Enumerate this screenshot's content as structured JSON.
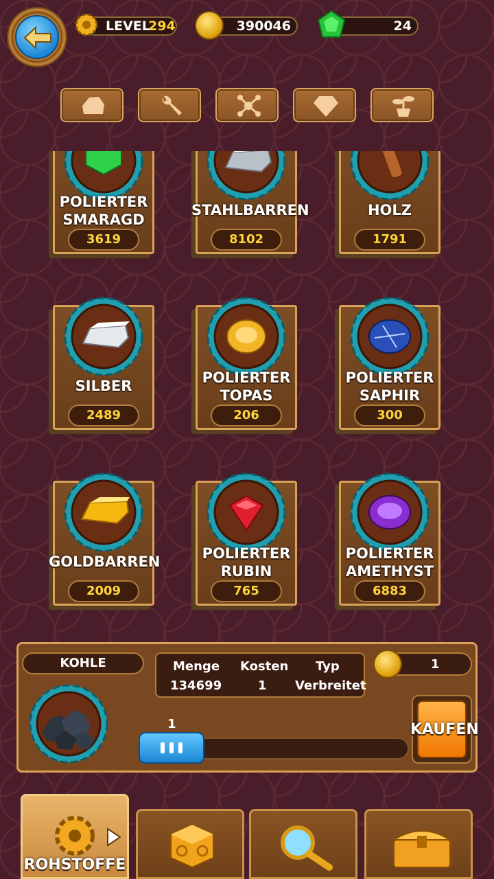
{
  "header": {
    "level_label": "LEVEL",
    "level_value": "294",
    "coins": "390046",
    "gems": "24"
  },
  "category_tabs": [
    {
      "icon": "rock-icon"
    },
    {
      "icon": "wrench-icon"
    },
    {
      "icon": "molecule-icon"
    },
    {
      "icon": "diamond-icon"
    },
    {
      "icon": "plant-icon"
    }
  ],
  "items": [
    {
      "name": "POLIERTER SMARAGD",
      "line1": "POLIERTER",
      "line2": "SMARAGD",
      "qty": "3619",
      "icon": "emerald-icon",
      "color": "#2ed14a"
    },
    {
      "name": "STAHLBARREN",
      "line1": "STAHLBARREN",
      "line2": "",
      "qty": "8102",
      "icon": "steel-bar-icon",
      "color": "#b9c0c8"
    },
    {
      "name": "HOLZ",
      "line1": "HOLZ",
      "line2": "",
      "qty": "1791",
      "icon": "wood-icon",
      "color": "#b5642c"
    },
    {
      "name": "SILBER",
      "line1": "SILBER",
      "line2": "",
      "qty": "2489",
      "icon": "silver-bar-icon",
      "color": "#e6e9ec"
    },
    {
      "name": "POLIERTER TOPAS",
      "line1": "POLIERTER",
      "line2": "TOPAS",
      "qty": "206",
      "icon": "topaz-icon",
      "color": "#f2b526"
    },
    {
      "name": "POLIERTER SAPHIR",
      "line1": "POLIERTER",
      "line2": "SAPHIR",
      "qty": "300",
      "icon": "sapphire-icon",
      "color": "#2a4fb8"
    },
    {
      "name": "GOLDBARREN",
      "line1": "GOLDBARREN",
      "line2": "",
      "qty": "2009",
      "icon": "gold-bar-icon",
      "color": "#f5b80f"
    },
    {
      "name": "POLIERTER RUBIN",
      "line1": "POLIERTER",
      "line2": "RUBIN",
      "qty": "765",
      "icon": "ruby-icon",
      "color": "#e0202c"
    },
    {
      "name": "POLIERTER AMETHYST",
      "line1": "POLIERTER",
      "line2": "AMETHYST",
      "qty": "6883",
      "icon": "amethyst-icon",
      "color": "#8a2ed0"
    }
  ],
  "detail": {
    "selected_name": "KOHLE",
    "headers": {
      "menge": "Menge",
      "kosten": "Kosten",
      "typ": "Typ"
    },
    "values": {
      "menge": "134699",
      "kosten": "1",
      "typ": "Verbreitet"
    },
    "price": "1",
    "slider_value": "1",
    "buy_label": "KAUFEN"
  },
  "bottom_nav": [
    {
      "label": "ROHSTOFFE",
      "icon": "gear-icon",
      "active": true
    },
    {
      "label": "",
      "icon": "dice-icon"
    },
    {
      "label": "",
      "icon": "magnifier-icon"
    },
    {
      "label": "",
      "icon": "chest-icon"
    }
  ],
  "colors": {
    "accent_gold": "#ffd43a",
    "panel_border": "#d9a258",
    "background": "#4a1d2a"
  }
}
